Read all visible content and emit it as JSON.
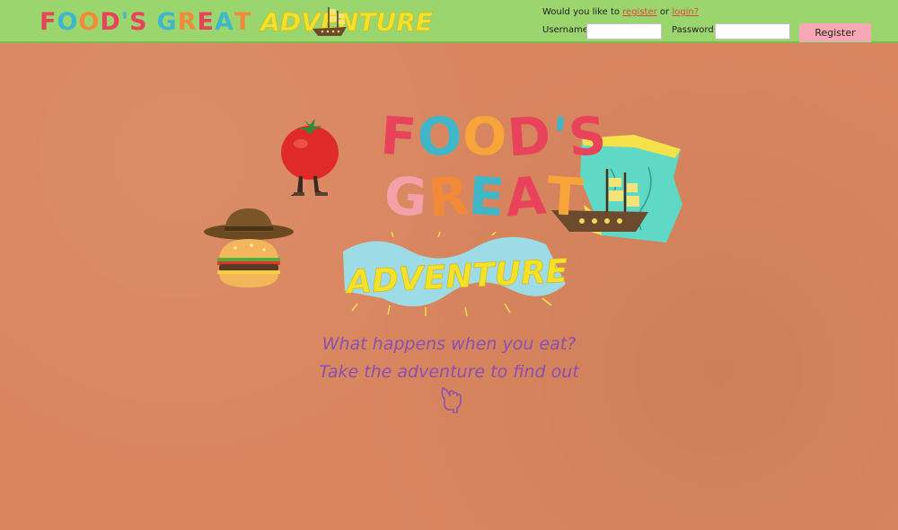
{
  "header": {
    "logo": {
      "word1": [
        "F",
        "O",
        "O",
        "D",
        "'",
        "S"
      ],
      "word2": [
        "G",
        "R",
        "E",
        "A",
        "T"
      ],
      "word3": "ADVENTURE",
      "colors1": [
        "#e9435c",
        "#3fb7c9",
        "#f28a3a",
        "#e9435c",
        "#3fb7c9",
        "#e9435c"
      ],
      "colors2": [
        "#3fb7c9",
        "#f28a3a",
        "#e9435c",
        "#3fb7c9",
        "#f28a3a"
      ]
    },
    "auth": {
      "prompt_prefix": "Would you like to ",
      "register_link": "register",
      "prompt_or": " or ",
      "login_link": "login?",
      "username_label": "Username:",
      "password_label": "Password:",
      "register_button": "Register"
    }
  },
  "hero": {
    "title_line1": [
      "F",
      "O",
      "O",
      "D",
      "'",
      "S"
    ],
    "title_line2": [
      "G",
      "R",
      "E",
      "A",
      "T"
    ],
    "title_line3": "ADVENTURE",
    "line1_colors": [
      "#e9435c",
      "#3fb7c9",
      "#f7a43b",
      "#e9435c",
      "#3fb7c9",
      "#e9435c"
    ],
    "line2_colors": [
      "#f4a0a8",
      "#f28a3a",
      "#3fb7c9",
      "#e9435c",
      "#f7a43b"
    ],
    "tagline_1": "What happens when you eat?",
    "tagline_2": "Take the adventure to find out"
  },
  "colors": {
    "background": "#d9865f",
    "header": "#9bd56e",
    "tagline": "#8a4fb0",
    "link": "#e0493a",
    "button": "#f6a8b5"
  }
}
